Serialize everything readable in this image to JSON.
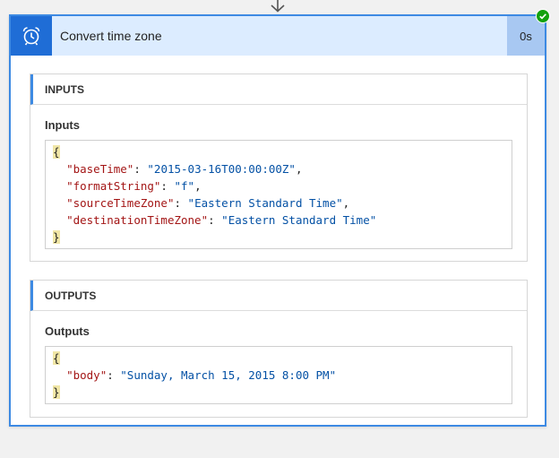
{
  "action": {
    "title": "Convert time zone",
    "duration": "0s",
    "icon": "alarm-clock-icon",
    "status_icon": "check-icon",
    "accent_color": "#1f6dd6",
    "status_color": "#13a10e"
  },
  "inputs": {
    "section_label": "INPUTS",
    "sub_label": "Inputs",
    "open_brace": "{",
    "close_brace": "}",
    "entries": [
      {
        "key": "\"baseTime\"",
        "value": "\"2015-03-16T00:00:00Z\"",
        "sep": ","
      },
      {
        "key": "\"formatString\"",
        "value": "\"f\"",
        "sep": ","
      },
      {
        "key": "\"sourceTimeZone\"",
        "value": "\"Eastern Standard Time\"",
        "sep": ","
      },
      {
        "key": "\"destinationTimeZone\"",
        "value": "\"Eastern Standard Time\"",
        "sep": ""
      }
    ]
  },
  "outputs": {
    "section_label": "OUTPUTS",
    "sub_label": "Outputs",
    "open_brace": "{",
    "close_brace": "}",
    "entries": [
      {
        "key": "\"body\"",
        "value": "\"Sunday, March 15, 2015 8:00 PM\"",
        "sep": ""
      }
    ]
  }
}
